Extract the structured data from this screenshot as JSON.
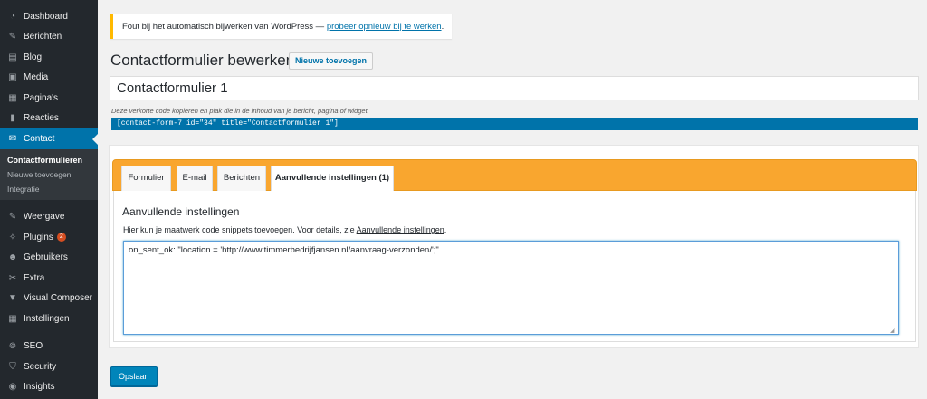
{
  "sidebar": {
    "items": [
      {
        "label": "Dashboard",
        "icon": "dashboard-icon",
        "glyph": "◔"
      },
      {
        "label": "Berichten",
        "icon": "pin-icon",
        "glyph": "✎"
      },
      {
        "label": "Blog",
        "icon": "blog-icon",
        "glyph": "▤"
      },
      {
        "label": "Media",
        "icon": "media-icon",
        "glyph": "▣"
      },
      {
        "label": "Pagina's",
        "icon": "pages-icon",
        "glyph": "▦"
      },
      {
        "label": "Reacties",
        "icon": "comments-icon",
        "glyph": "▮"
      },
      {
        "label": "Contact",
        "icon": "mail-icon",
        "glyph": "✉"
      }
    ],
    "submenu": [
      "Contactformulieren",
      "Nieuwe toevoegen",
      "Integratie"
    ],
    "items2": [
      {
        "label": "Weergave",
        "icon": "appearance-icon",
        "glyph": "✎"
      },
      {
        "label": "Plugins",
        "icon": "plugins-icon",
        "glyph": "✧",
        "badge": "2"
      },
      {
        "label": "Gebruikers",
        "icon": "users-icon",
        "glyph": "☻"
      },
      {
        "label": "Extra",
        "icon": "tools-icon",
        "glyph": "✂"
      },
      {
        "label": "Visual Composer",
        "icon": "visual-composer-icon",
        "glyph": "▼"
      },
      {
        "label": "Instellingen",
        "icon": "settings-icon",
        "glyph": "▦"
      }
    ],
    "items3": [
      {
        "label": "SEO",
        "icon": "seo-icon",
        "glyph": "⊚"
      },
      {
        "label": "Security",
        "icon": "shield-icon",
        "glyph": "⛉"
      },
      {
        "label": "Insights",
        "icon": "insights-icon",
        "glyph": "◉"
      }
    ]
  },
  "notice": {
    "text": "Fout bij het automatisch bijwerken van WordPress — ",
    "link": "probeer opnieuw bij te werken",
    "suffix": "."
  },
  "page": {
    "title": "Contactformulier bewerken",
    "add_new": "Nieuwe toevoegen",
    "form_title": "Contactformulier 1",
    "shortcode_desc": "Deze verkorte code kopiëren en plak die in de inhoud van je bericht, pagina of widget.",
    "shortcode": "[contact-form-7 id=\"34\" title=\"Contactformulier 1\"]"
  },
  "tabs": [
    "Formulier",
    "E-mail",
    "Berichten",
    "Aanvullende instellingen (1)"
  ],
  "section": {
    "title": "Aanvullende instellingen",
    "desc": "Hier kun je maatwerk code snippets toevoegen. Voor details, zie ",
    "desc_link": "Aanvullende instellingen",
    "desc_suffix": ".",
    "code": "on_sent_ok: \"location = 'http://www.timmerbedrijfjansen.nl/aanvraag-verzonden/';\""
  },
  "save_label": "Opslaan"
}
